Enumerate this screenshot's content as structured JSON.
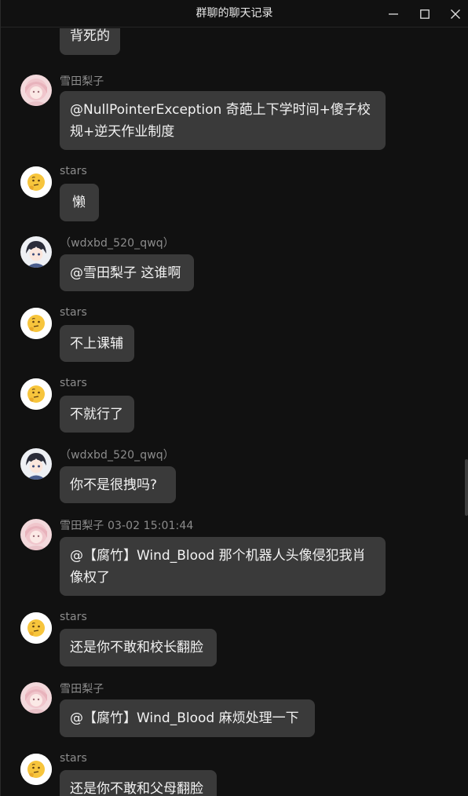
{
  "window": {
    "title": "群聊的聊天记录"
  },
  "colors": {
    "background": "#111111",
    "bubble": "#3a3a3a",
    "name_text": "#8c8c8c",
    "message_text": "#f2f2f2"
  },
  "messages": [
    {
      "avatar": "partial-avatar",
      "sender": "",
      "text": "背死的"
    },
    {
      "avatar": "anime-girl-avatar",
      "sender": "雪田梨子",
      "text": "@NullPointerException 奇葩上下学时间+傻子校规+逆天作业制度"
    },
    {
      "avatar": "thinking-face-emoji",
      "sender": "stars",
      "text": "懒"
    },
    {
      "avatar": "anime-boy-avatar",
      "sender": "（wdxbd_520_qwq）",
      "text": "@雪田梨子 这谁啊"
    },
    {
      "avatar": "thinking-face-emoji",
      "sender": "stars",
      "text": "不上课辅"
    },
    {
      "avatar": "thinking-face-emoji",
      "sender": "stars",
      "text": "不就行了"
    },
    {
      "avatar": "anime-boy-avatar",
      "sender": "（wdxbd_520_qwq）",
      "text": "你不是很拽吗?"
    },
    {
      "avatar": "anime-girl-avatar",
      "sender": "雪田梨子 03-02 15:01:44",
      "text": "@【腐竹】Wind_Blood 那个机器人头像侵犯我肖像权了"
    },
    {
      "avatar": "thinking-face-emoji",
      "sender": "stars",
      "text": "还是你不敢和校长翻脸"
    },
    {
      "avatar": "anime-girl-avatar",
      "sender": "雪田梨子",
      "text": "@【腐竹】Wind_Blood 麻烦处理一下"
    },
    {
      "avatar": "thinking-face-emoji",
      "sender": "stars",
      "text": "还是你不敢和父母翻脸"
    }
  ]
}
